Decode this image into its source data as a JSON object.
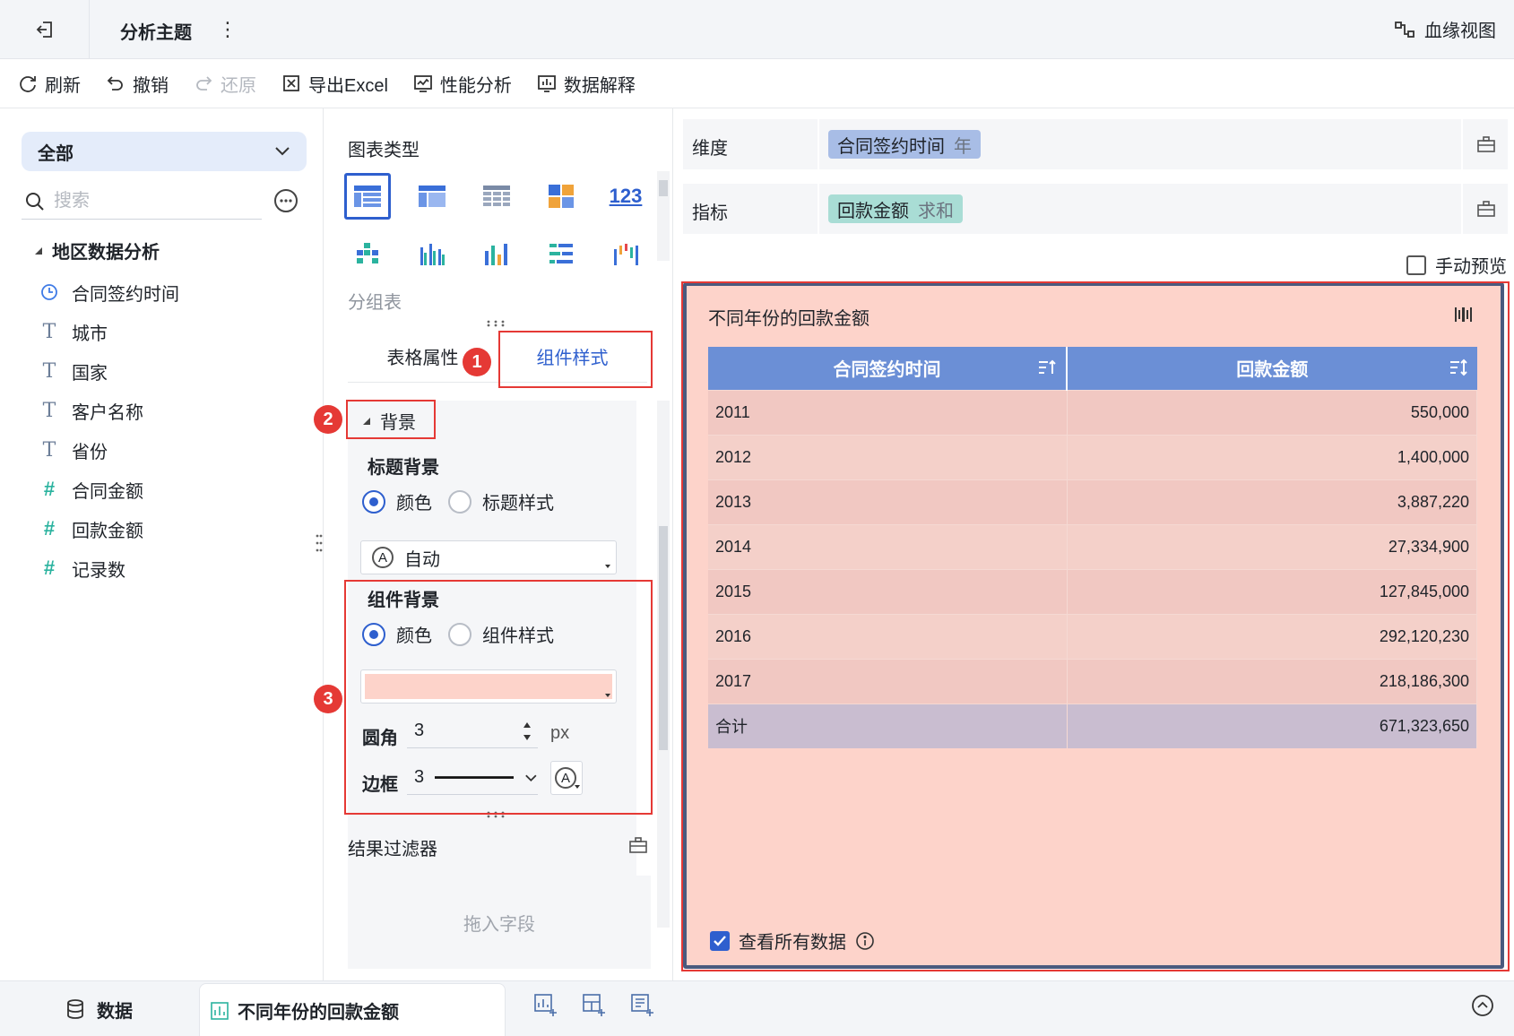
{
  "header": {
    "title": "分析主题",
    "more": "⋮",
    "lineage_label": "血缘视图"
  },
  "toolbar": {
    "refresh": "刷新",
    "undo": "撤销",
    "redo": "还原",
    "export_excel": "导出Excel",
    "performance": "性能分析",
    "explain": "数据解释"
  },
  "left": {
    "scope": "全部",
    "search_placeholder": "搜索",
    "dataset": "地区数据分析",
    "fields": [
      {
        "name": "合同签约时间",
        "icon": "clock-icon"
      },
      {
        "name": "城市",
        "icon": "T"
      },
      {
        "name": "国家",
        "icon": "T"
      },
      {
        "name": "客户名称",
        "icon": "T"
      },
      {
        "name": "省份",
        "icon": "T"
      },
      {
        "name": "合同金额",
        "icon": "#"
      },
      {
        "name": "回款金额",
        "icon": "#"
      },
      {
        "name": "记录数",
        "icon": "#"
      }
    ]
  },
  "middle": {
    "chart_type_title": "图表类型",
    "chart_type_123": "123",
    "chart_type_name": "分组表",
    "tabs": [
      "表格属性",
      "组件样式"
    ],
    "background_section": "背景",
    "title_bg": {
      "title": "标题背景",
      "option_color": "颜色",
      "option_style": "标题样式",
      "auto_label": "自动",
      "auto_icon_letter": "A"
    },
    "widget_bg": {
      "title": "组件背景",
      "option_color": "颜色",
      "option_style": "组件样式",
      "color_value": "#fdd3ca",
      "radius_label": "圆角",
      "radius_value": "3",
      "radius_unit": "px",
      "border_label": "边框",
      "border_value": "3",
      "border_color_icon_letter": "A"
    },
    "filter_title": "结果过滤器",
    "filter_placeholder": "拖入字段"
  },
  "callouts": [
    "1",
    "2",
    "3"
  ],
  "right": {
    "dimension_label": "维度",
    "dimension_field": "合同签约时间",
    "dimension_agg": "年",
    "measure_label": "指标",
    "measure_field": "回款金额",
    "measure_agg": "求和",
    "manual_preview": "手动预览",
    "widget": {
      "title": "不同年份的回款金额",
      "columns": [
        "合同签约时间",
        "回款金额"
      ],
      "rows": [
        [
          "2011",
          "550,000"
        ],
        [
          "2012",
          "1,400,000"
        ],
        [
          "2013",
          "3,887,220"
        ],
        [
          "2014",
          "27,334,900"
        ],
        [
          "2015",
          "127,845,000"
        ],
        [
          "2016",
          "292,120,230"
        ],
        [
          "2017",
          "218,186,300"
        ]
      ],
      "total": [
        "合计",
        "671,323,650"
      ],
      "view_all": "查看所有数据"
    }
  },
  "bottom": {
    "data_tab": "数据",
    "sheet_tab": "不同年份的回款金额"
  },
  "colors": {
    "accent": "#2e5fce",
    "highlight": "#e53935",
    "widget_bg": "#fdd3ca",
    "table_header": "#6b8fd6",
    "measure_pill": "#a9ddd5",
    "dimension_pill": "#a8bde6"
  }
}
